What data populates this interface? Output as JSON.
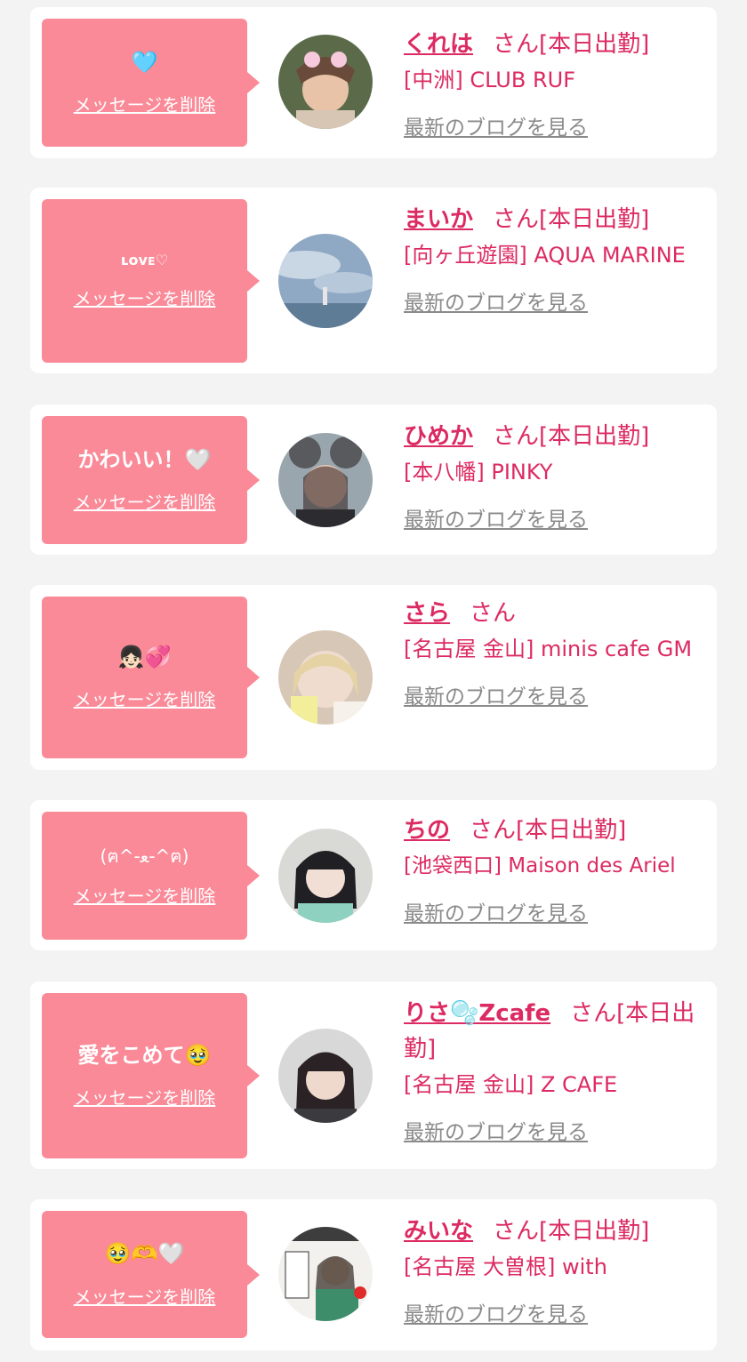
{
  "colors": {
    "accent": "#dc2a62",
    "bubble": "#fa8a98",
    "link_gray": "#8a8a8a"
  },
  "labels": {
    "delete_message": "メッセージを削除",
    "latest_blog": "最新のブログを見る",
    "honorific": "さん"
  },
  "entries": [
    {
      "message": "🩵",
      "name": "くれは",
      "status": "[本日出勤]",
      "shop": "[中洲] CLUB RUF"
    },
    {
      "message": "ʟᴏᴠᴇ♡",
      "name": "まいか",
      "status": "[本日出勤]",
      "shop": "[向ヶ丘遊園] AQUA MARINE"
    },
    {
      "message": "かわいい！🤍",
      "name": "ひめか",
      "status": "[本日出勤]",
      "shop": "[本八幡] PINKY"
    },
    {
      "message": "👧🏻💞",
      "name": "さら",
      "status": "",
      "shop": "[名古屋 金山] minis cafe GM"
    },
    {
      "message": "(ฅ^-ﻌ-^ฅ)",
      "name": "ちの",
      "status": "[本日出勤]",
      "shop": "[池袋西口] Maison des Ariel"
    },
    {
      "message": "愛をこめて🥹",
      "name": "りさ🫧Zcafe",
      "status": "[本日出勤]",
      "shop": "[名古屋 金山] Z CAFE"
    },
    {
      "message": "🥹🫶🤍",
      "name": "みいな",
      "status": "[本日出勤]",
      "shop": "[名古屋 大曽根] with"
    }
  ]
}
